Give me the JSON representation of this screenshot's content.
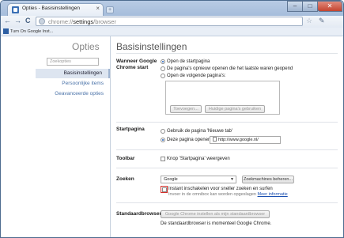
{
  "window": {
    "tab_title": "Opties - Basisinstellingen",
    "tab_close": "×",
    "new_tab": "+",
    "min": "–",
    "max": "□",
    "close": "✕"
  },
  "toolbar": {
    "back": "←",
    "forward": "→",
    "reload": "C",
    "url_scheme": "chrome://",
    "url_host": "settings",
    "url_path": "/browser",
    "star": "☆",
    "wrench": "✎"
  },
  "bookmarks": {
    "item": "Turn On Google Inst..."
  },
  "sidebar": {
    "title": "Opties",
    "search_placeholder": "Zoekopties",
    "items": [
      {
        "label": "Basisinstellingen",
        "active": true
      },
      {
        "label": "Persoonlijke items",
        "active": false
      },
      {
        "label": "Geavanceerde opties",
        "active": false
      }
    ]
  },
  "main": {
    "title": "Basisinstellingen",
    "startup": {
      "label": "Wanneer Google Chrome start",
      "options": [
        {
          "label": "Open de startpagina",
          "checked": true
        },
        {
          "label": "De pagina's opnieuw openen die het laatste waren geopend",
          "checked": false
        },
        {
          "label": "Open de volgende pagina's:",
          "checked": false
        }
      ],
      "add_button": "Toevoegen...",
      "use_current_button": "Huidige pagina's gebruiken"
    },
    "homepage": {
      "label": "Startpagina",
      "options": [
        {
          "label": "Gebruik de pagina 'Nieuwe tab'",
          "checked": false
        },
        {
          "label": "Deze pagina openen:",
          "checked": true
        }
      ],
      "url_value": "http://www.google.nl/"
    },
    "toolbar_section": {
      "label": "Toolbar",
      "checkbox_label": "Knop 'Startpagina' weergeven"
    },
    "search": {
      "label": "Zoeken",
      "engine": "Google",
      "manage_button": "Zoekmachines beheren...",
      "instant_label": "Instant inschakelen voor sneller zoeken en surfen",
      "instant_sub": "Invoer in de omnibox kan worden opgeslagen",
      "more_info": "Meer informatie"
    },
    "default_browser": {
      "label": "Standaardbrowser",
      "button": "Google Chrome instellen als mijn standaardbrowser",
      "status": "De standaardbrowser is momenteel Google Chrome."
    }
  }
}
